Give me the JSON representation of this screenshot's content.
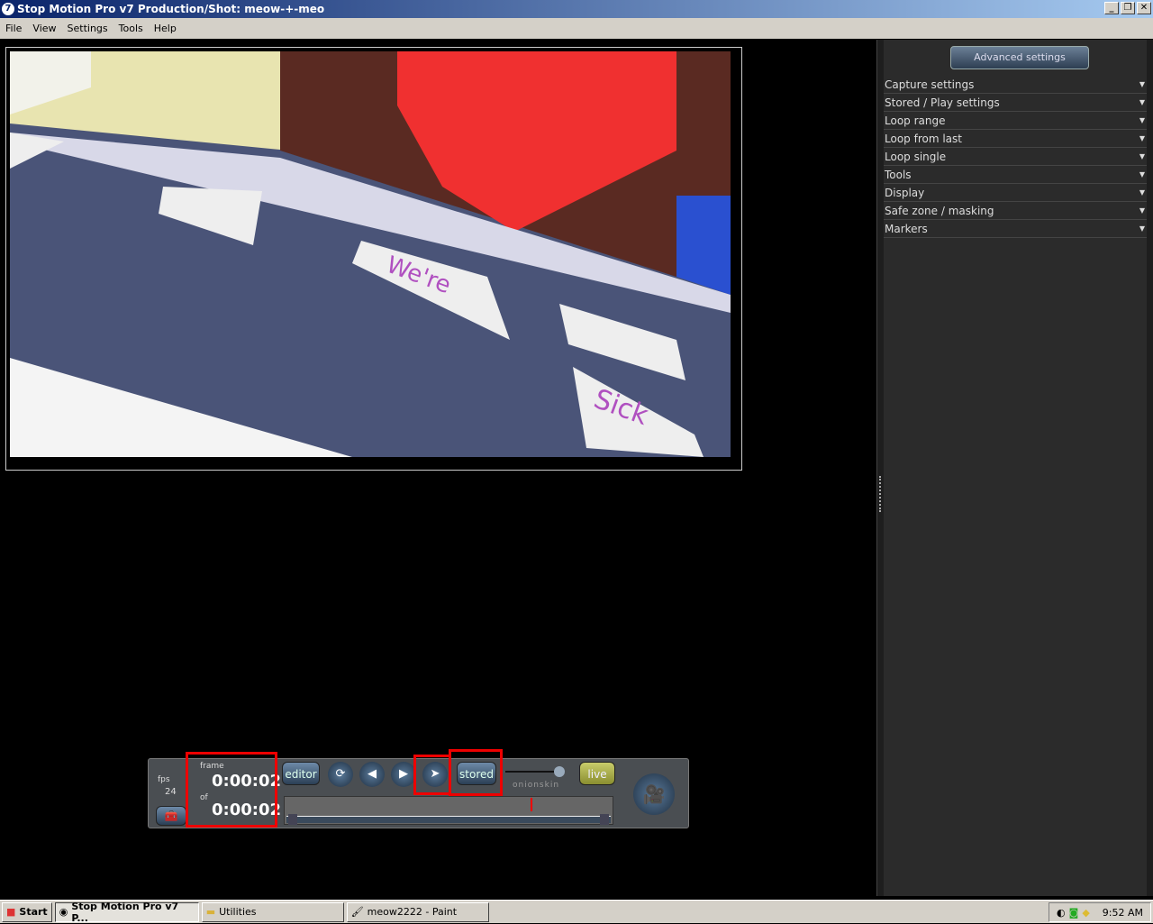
{
  "window": {
    "title": "Stop Motion Pro v7  Production/Shot: meow-+-meo",
    "app_icon": "7"
  },
  "menu": [
    "File",
    "View",
    "Settings",
    "Tools",
    "Help"
  ],
  "sidebar": {
    "advanced_label": "Advanced settings",
    "sections": [
      "Capture settings",
      "Stored / Play settings",
      "Loop range",
      "Loop from last",
      "Loop single",
      "Tools",
      "Display",
      "Safe zone / masking",
      "Markers"
    ]
  },
  "viewer": {
    "note1": "We're",
    "note2": "Sick"
  },
  "controls": {
    "fps_label": "fps",
    "fps_value": "24",
    "frame_label": "frame",
    "frame_value": "0:00:02",
    "of_label": "of",
    "of_value": "0:00:02",
    "editor": "editor",
    "stored": "stored",
    "onionskin": "onionskin",
    "live": "live",
    "onionskin_level": 0.9,
    "playhead_fraction": 0.75
  },
  "taskbar": {
    "start": "Start",
    "tasks": [
      "Stop Motion Pro v7  P...",
      "Utilities",
      "meow2222 - Paint"
    ],
    "time": "9:52 AM"
  }
}
